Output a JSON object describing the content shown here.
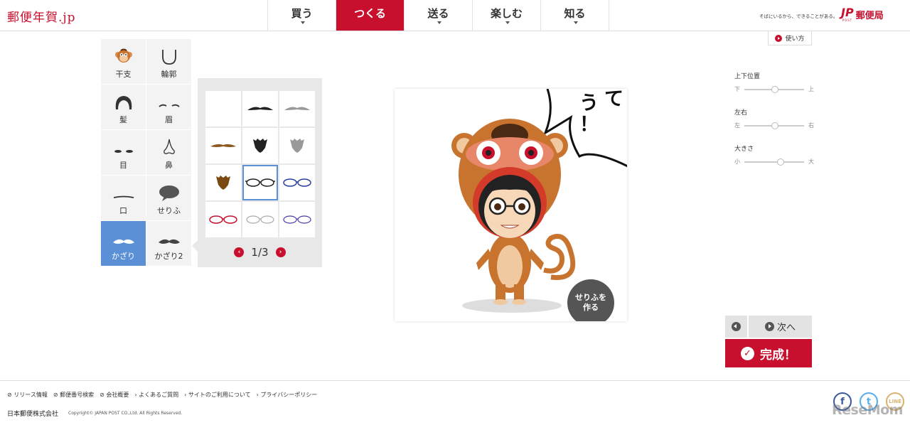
{
  "header": {
    "site_logo": "郵便年賀.jp",
    "nav": [
      {
        "label": "買う",
        "active": false
      },
      {
        "label": "つくる",
        "active": true
      },
      {
        "label": "送る",
        "active": false
      },
      {
        "label": "楽しむ",
        "active": false
      },
      {
        "label": "知る",
        "active": false
      }
    ],
    "tagline": "そばにいるから、できることがある。",
    "brand_mark": "JP",
    "brand_sub": "POST",
    "brand_name": "郵便局",
    "howto_label": "使い方"
  },
  "categories": [
    {
      "label": "干支",
      "icon": "zodiac-monkey-icon"
    },
    {
      "label": "輪郭",
      "icon": "face-outline-icon"
    },
    {
      "label": "髪",
      "icon": "hair-icon"
    },
    {
      "label": "眉",
      "icon": "eyebrow-icon"
    },
    {
      "label": "目",
      "icon": "eyes-icon"
    },
    {
      "label": "鼻",
      "icon": "nose-icon"
    },
    {
      "label": "口",
      "icon": "mouth-icon"
    },
    {
      "label": "せりふ",
      "icon": "speech-bubble-icon"
    },
    {
      "label": "かざり",
      "icon": "mustache-icon",
      "active": true
    },
    {
      "label": "かざり2",
      "icon": "mustache-icon"
    }
  ],
  "parts": {
    "items": [
      "empty",
      "black-mustache",
      "gray-mustache",
      "brown-mustache",
      "black-beard",
      "gray-beard",
      "brown-beard",
      "black-glasses",
      "blue-glasses",
      "red-glasses",
      "silver-glasses",
      "navy-glasses"
    ],
    "selected_index": 7,
    "page_label": "1/3"
  },
  "preview": {
    "speech_col1": "う！",
    "speech_col2": "て",
    "serif_button": "せりふを作る",
    "serif_line1": "せりふを",
    "serif_line2": "作る"
  },
  "adjust": [
    {
      "title": "上下位置",
      "min_label": "下",
      "max_label": "上",
      "value": 0.5
    },
    {
      "title": "左右",
      "min_label": "左",
      "max_label": "右",
      "value": 0.5
    },
    {
      "title": "大きさ",
      "min_label": "小",
      "max_label": "大",
      "value": 0.6
    }
  ],
  "controls": {
    "next_label": "次へ",
    "done_label": "完成！"
  },
  "footer": {
    "links": [
      "リリース情報",
      "郵便番号検索",
      "会社概要",
      "よくあるご質問",
      "サイトのご利用について",
      "プライバシーポリシー"
    ],
    "company": "日本郵便株式会社",
    "copyright": "Copyright© JAPAN POST CO.,Ltd. All Rights Reserved.",
    "social": [
      "facebook-icon",
      "twitter-icon",
      "line-icon"
    ],
    "watermark": "ReseMom"
  },
  "colors": {
    "brand_red": "#c8102e",
    "active_blue": "#5b8fd6"
  }
}
